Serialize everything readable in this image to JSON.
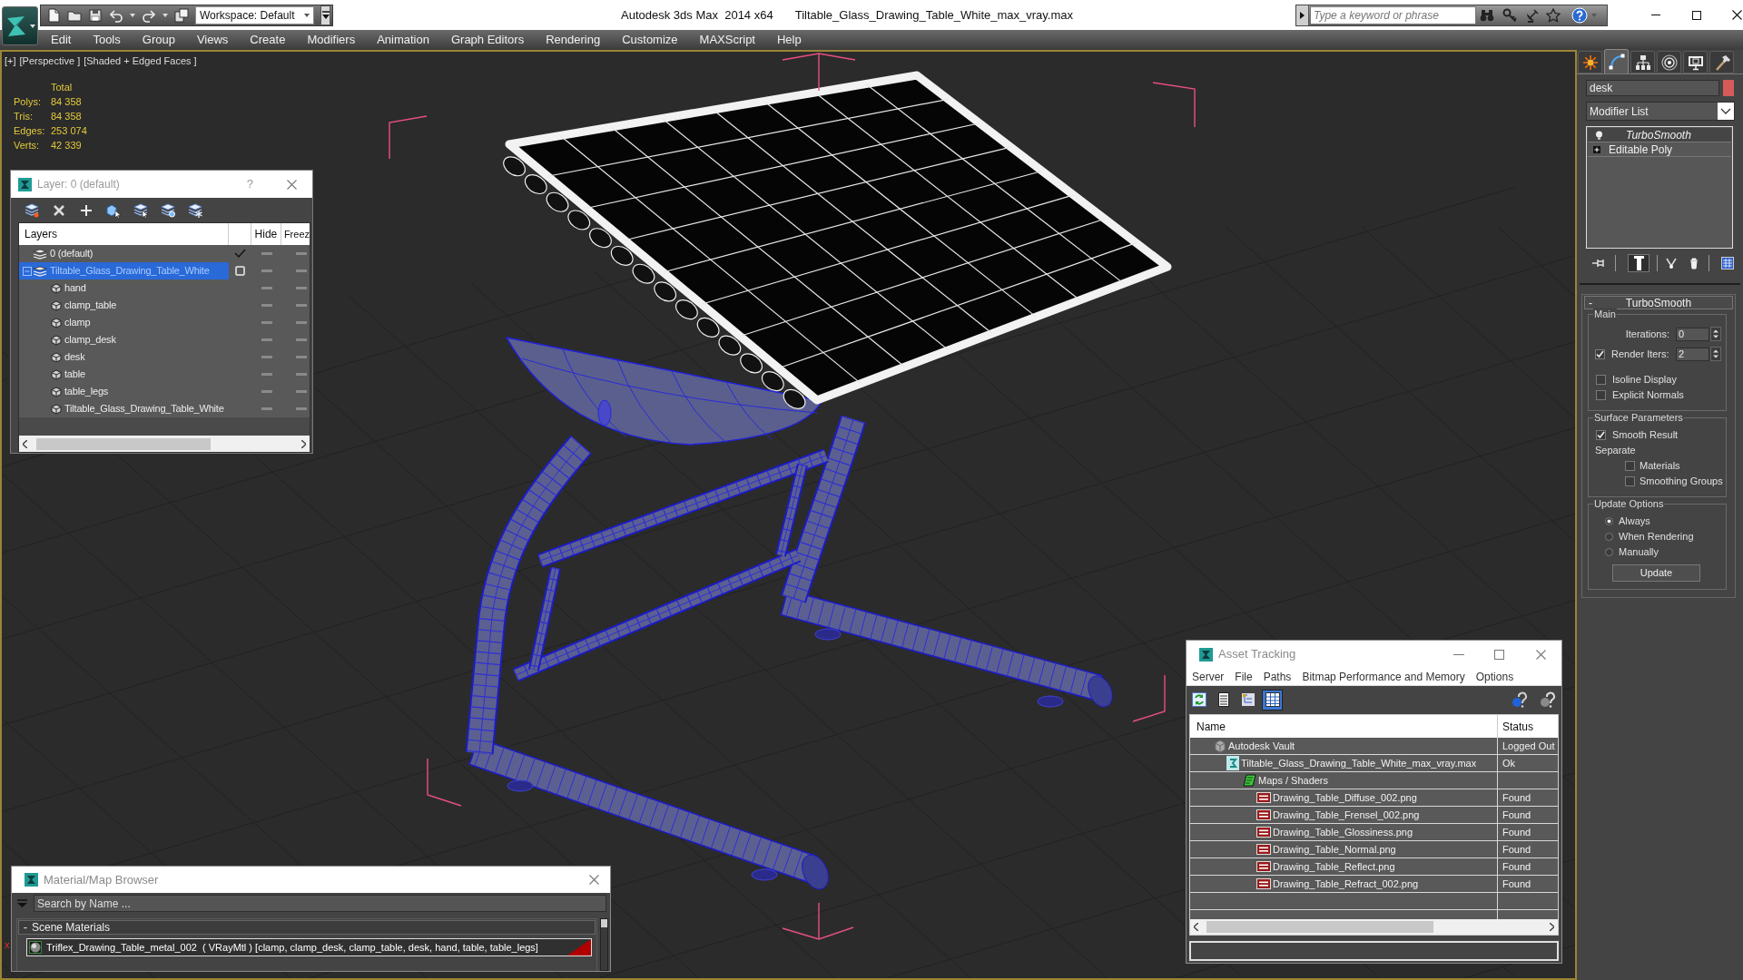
{
  "title_bar": {
    "app_title": "Autodesk 3ds Max  2014 x64",
    "file_name": "Tiltable_Glass_Drawing_Table_White_max_vray.max",
    "workspace": "Workspace: Default",
    "search_placeholder": "Type a keyword or phrase"
  },
  "menu": [
    "Edit",
    "Tools",
    "Group",
    "Views",
    "Create",
    "Modifiers",
    "Animation",
    "Graph Editors",
    "Rendering",
    "Customize",
    "MAXScript",
    "Help"
  ],
  "viewport": {
    "labels": [
      "[+]",
      "[Perspective ]",
      "[Shaded + Edged Faces ]"
    ],
    "stats_header": "Total",
    "stats": [
      {
        "label": "Polys:",
        "value": "84 358"
      },
      {
        "label": "Tris:",
        "value": "84 358"
      },
      {
        "label": "Edges:",
        "value": "253 074"
      },
      {
        "label": "Verts:",
        "value": "42 339"
      }
    ],
    "axis_label": "x"
  },
  "layer_explorer": {
    "title": "Layer: 0 (default)",
    "help": "?",
    "columns": [
      "Layers",
      "Hide",
      "Freez"
    ],
    "layers": [
      {
        "name": "0 (default)",
        "current": true,
        "selected": false,
        "hidden": false,
        "frozen": false
      },
      {
        "name": "Tiltable_Glass_Drawing_Table_White",
        "current": false,
        "selected": true,
        "expanded": true,
        "hidden": false,
        "frozen": false,
        "children": [
          {
            "name": "hand",
            "selected": false,
            "hidden": false,
            "frozen": false
          },
          {
            "name": "clamp_table",
            "selected": false,
            "hidden": false,
            "frozen": false
          },
          {
            "name": "clamp",
            "selected": false,
            "hidden": false,
            "frozen": false
          },
          {
            "name": "clamp_desk",
            "selected": false,
            "hidden": false,
            "frozen": false
          },
          {
            "name": "desk",
            "selected": false,
            "hidden": false,
            "frozen": false
          },
          {
            "name": "table",
            "selected": false,
            "hidden": false,
            "frozen": false
          },
          {
            "name": "table_legs",
            "selected": false,
            "hidden": false,
            "frozen": false
          },
          {
            "name": "Tiltable_Glass_Drawing_Table_White",
            "selected": false,
            "hidden": false,
            "frozen": false
          }
        ]
      }
    ]
  },
  "command_panel": {
    "tabs": [
      {
        "selected": false
      },
      {
        "selected": true
      },
      {
        "selected": false
      },
      {
        "selected": false
      },
      {
        "selected": false
      },
      {
        "selected": false
      }
    ],
    "object_name": "desk",
    "modifier_list": "Modifier List",
    "stack": [
      {
        "name": "TurboSmooth",
        "kind": "modifier",
        "selected": true
      },
      {
        "name": "Editable Poly",
        "kind": "base_object",
        "selected": false
      }
    ],
    "show_end_result": true,
    "rollout": {
      "toggle": "-",
      "title": "TurboSmooth",
      "groups": [
        {
          "title": "Main",
          "controls": [
            {
              "kind": "spinner",
              "label": "Iterations:",
              "value": "0"
            },
            {
              "kind": "check_spinner",
              "label": "Render Iters:",
              "checked": true,
              "value": "2"
            },
            {
              "kind": "checkbox",
              "label": "Isoline Display",
              "checked": false
            },
            {
              "kind": "checkbox",
              "label": "Explicit Normals",
              "checked": false
            }
          ]
        },
        {
          "title": "Surface Parameters",
          "controls": [
            {
              "kind": "checkbox",
              "label": "Smooth Result",
              "checked": true
            },
            {
              "kind": "label",
              "label": "Separate"
            },
            {
              "kind": "sub_checkbox",
              "label": "Materials",
              "checked": false
            },
            {
              "kind": "sub_checkbox",
              "label": "Smoothing Groups",
              "checked": false
            }
          ]
        },
        {
          "title": "Update Options",
          "controls": [
            {
              "kind": "radio",
              "label": "Always",
              "selected": true
            },
            {
              "kind": "radio",
              "label": "When Rendering",
              "selected": false
            },
            {
              "kind": "radio",
              "label": "Manually",
              "selected": false
            },
            {
              "kind": "button",
              "label": "Update"
            }
          ]
        }
      ]
    }
  },
  "asset_tracking": {
    "title": "Asset Tracking",
    "menu": [
      "Server",
      "File",
      "Paths",
      "Bitmap Performance and Memory",
      "Options"
    ],
    "view_buttons": [
      {
        "selected": false
      },
      {
        "selected": false
      },
      {
        "selected": false
      },
      {
        "selected": true
      }
    ],
    "columns": [
      "Name",
      "Status"
    ],
    "rows": [
      {
        "kind": "vault",
        "name": "Autodesk Vault",
        "status": "Logged Out",
        "selected": false,
        "children": [
          {
            "kind": "scene",
            "name": "Tiltable_Glass_Drawing_Table_White_max_vray.max",
            "status": "Ok",
            "selected": false,
            "children": [
              {
                "kind": "folder",
                "name": "Maps / Shaders",
                "selected": false,
                "children": [
                  {
                    "kind": "image",
                    "name": "Drawing_Table_Diffuse_002.png",
                    "status": "Found",
                    "selected": false
                  },
                  {
                    "kind": "image",
                    "name": "Drawing_Table_Frensel_002.png",
                    "status": "Found",
                    "selected": false
                  },
                  {
                    "kind": "image",
                    "name": "Drawing_Table_Glossiness.png",
                    "status": "Found",
                    "selected": false
                  },
                  {
                    "kind": "image",
                    "name": "Drawing_Table_Normal.png",
                    "status": "Found",
                    "selected": false
                  },
                  {
                    "kind": "image",
                    "name": "Drawing_Table_Reflect.png",
                    "status": "Found",
                    "selected": false
                  },
                  {
                    "kind": "image",
                    "name": "Drawing_Table_Refract_002.png",
                    "status": "Found",
                    "selected": false
                  }
                ]
              }
            ]
          }
        ]
      }
    ]
  },
  "material_browser": {
    "title": "Material/Map Browser",
    "search_placeholder": "Search by Name ...",
    "group": {
      "toggle": "-",
      "title": "Scene Materials",
      "materials": [
        {
          "name": "Triflex_Drawing_Table_metal_002  ( VRayMtl ) [clamp, clamp_desk, clamp_table, desk, hand, table, table_legs]"
        }
      ]
    }
  }
}
